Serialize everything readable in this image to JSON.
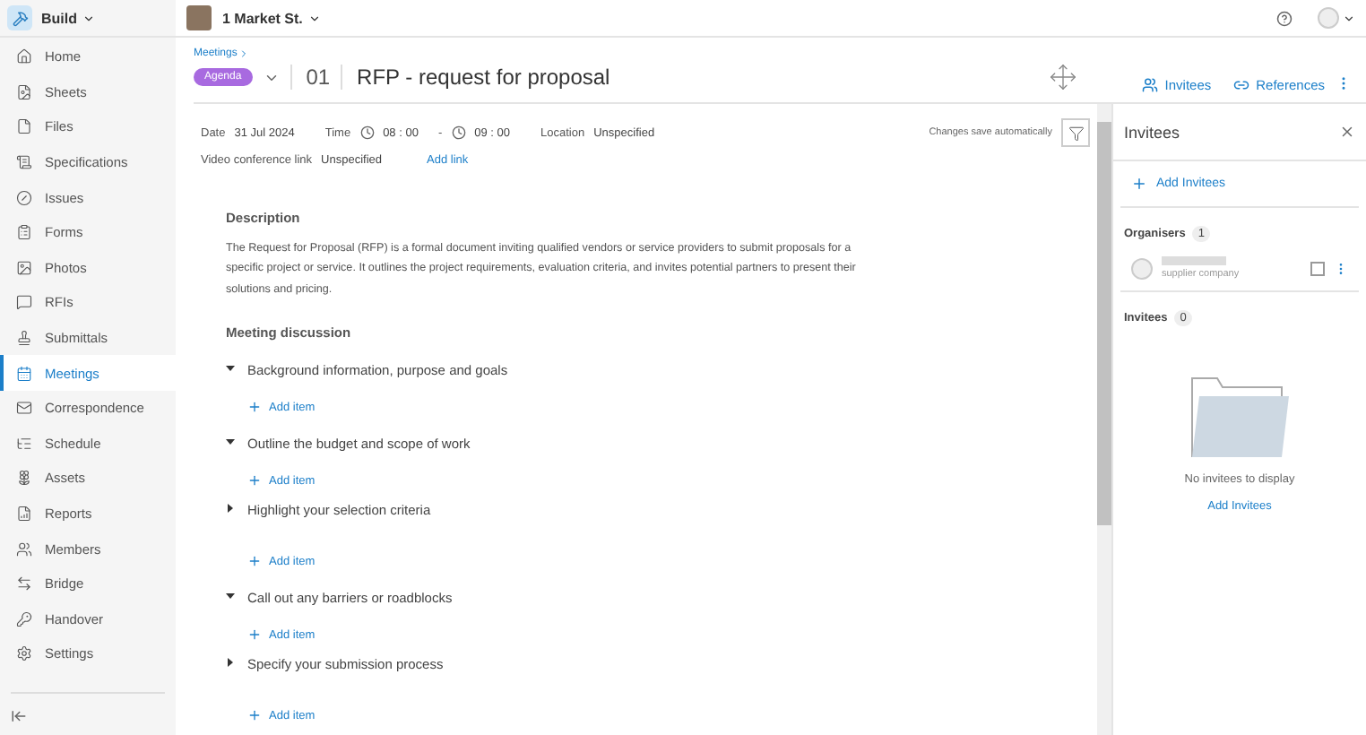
{
  "topbar": {
    "app": "Build",
    "project": "1 Market St."
  },
  "sidebar": {
    "items": [
      {
        "label": "Home",
        "selected": false
      },
      {
        "label": "Sheets",
        "selected": false
      },
      {
        "label": "Files",
        "selected": false
      },
      {
        "label": "Specifications",
        "selected": false
      },
      {
        "label": "Issues",
        "selected": false
      },
      {
        "label": "Forms",
        "selected": false
      },
      {
        "label": "Photos",
        "selected": false
      },
      {
        "label": "RFIs",
        "selected": false
      },
      {
        "label": "Submittals",
        "selected": false
      },
      {
        "label": "Meetings",
        "selected": true
      },
      {
        "label": "Correspondence",
        "selected": false
      },
      {
        "label": "Schedule",
        "selected": false
      },
      {
        "label": "Assets",
        "selected": false
      },
      {
        "label": "Reports",
        "selected": false
      },
      {
        "label": "Members",
        "selected": false
      },
      {
        "label": "Bridge",
        "selected": false
      },
      {
        "label": "Handover",
        "selected": false
      },
      {
        "label": "Settings",
        "selected": false
      }
    ]
  },
  "header": {
    "breadcrumb": "Meetings",
    "status": "Agenda",
    "number": "01",
    "title": "RFP - request for proposal",
    "actions": [
      {
        "label": "Invitees"
      },
      {
        "label": "References"
      }
    ]
  },
  "details": {
    "date_label": "Date",
    "date": "31 Jul 2024",
    "time_label": "Time",
    "start": "08 : 00",
    "separator": "-",
    "end": "09 : 00",
    "location_label": "Location",
    "location": "Unspecified",
    "video_label": "Video conference link",
    "video": "Unspecified",
    "add_link": "Add link",
    "save_note": "Changes save automatically"
  },
  "description": {
    "heading": "Description",
    "text": "The Request for Proposal (RFP) is a formal document inviting qualified vendors or service providers to submit proposals for a specific project or service. It outlines the project requirements, evaluation criteria, and invites potential partners to present their solutions and pricing."
  },
  "discussion": {
    "heading": "Meeting discussion",
    "topics": [
      {
        "title": "Background information, purpose and goals",
        "expanded": true,
        "add_label": "Add item"
      },
      {
        "title": "Outline the budget and scope of work",
        "expanded": true,
        "add_label": "Add item"
      },
      {
        "title": "Highlight your selection criteria",
        "expanded": false,
        "add_label": "Add item"
      },
      {
        "title": "Call out any barriers or roadblocks",
        "expanded": true,
        "add_label": "Add item"
      },
      {
        "title": "Specify your submission process",
        "expanded": false,
        "add_label": "Add item"
      }
    ]
  },
  "panel": {
    "title": "Invitees",
    "add_button": "Add Invitees",
    "organisers": {
      "label": "Organisers",
      "count": "1",
      "people": [
        {
          "company": "supplier company",
          "checked": false
        }
      ]
    },
    "invitees": {
      "label": "Invitees",
      "count": "0",
      "empty_text": "No invitees to display",
      "add_link": "Add Invitees"
    }
  }
}
